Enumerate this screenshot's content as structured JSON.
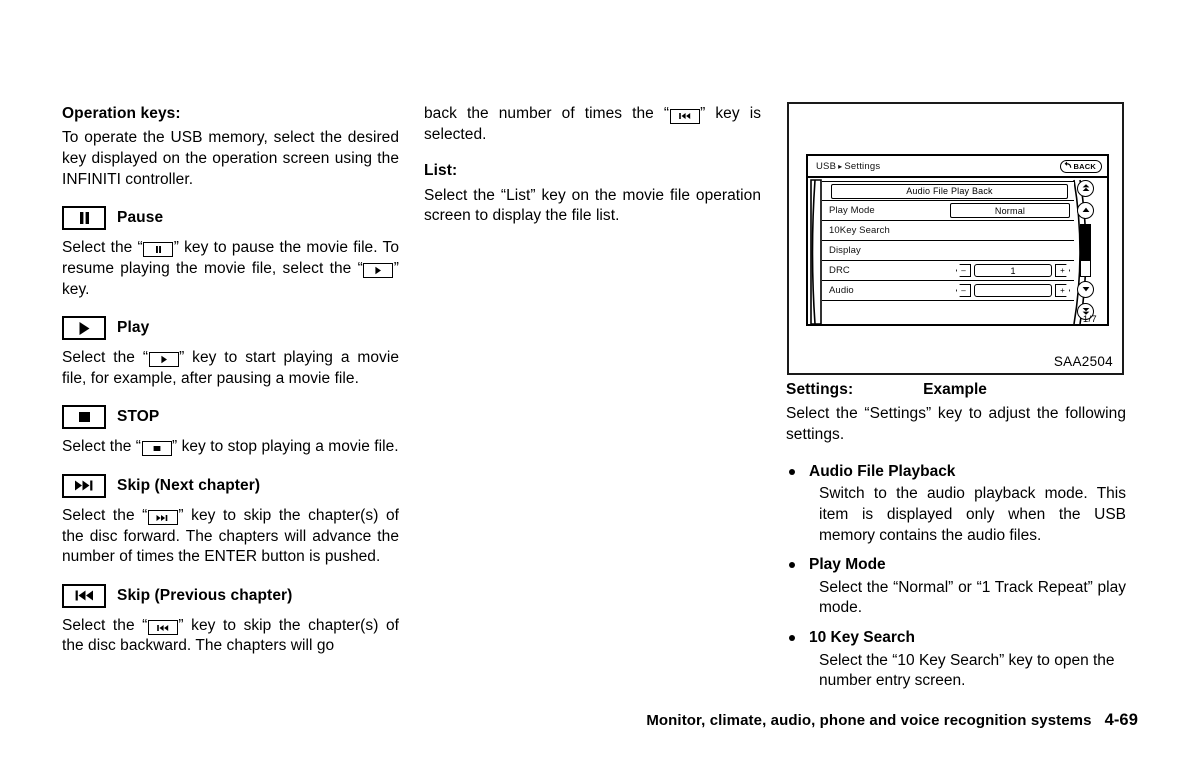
{
  "column_1": {
    "heading": "Operation keys:",
    "intro": "To operate the USB memory, select the desired key displayed on the operation screen using the INFINITI controller.",
    "keys": [
      {
        "icon": "pause-icon",
        "label": "Pause",
        "text_before": "Select the “",
        "text_after": "” key to pause the movie file. To resume playing the movie file, select the “",
        "text_end": "” key.",
        "inline_icon_1": "pause-icon",
        "inline_icon_2": "play-icon"
      },
      {
        "icon": "play-icon",
        "label": "Play",
        "text_before": "Select the “",
        "text_after": "” key to start playing a movie file, for example, after pausing a movie file.",
        "inline_icon_1": "play-icon"
      },
      {
        "icon": "stop-icon",
        "label": "STOP",
        "text_before": "Select the “",
        "text_after": "” key to stop playing a movie file.",
        "inline_icon_1": "stop-icon"
      },
      {
        "icon": "skip-next-icon",
        "label": "Skip (Next chapter)",
        "text_before": "Select the “",
        "text_after": "” key to skip the chapter(s) of the disc forward. The chapters will advance the number of times the ENTER button is pushed.",
        "inline_icon_1": "skip-next-icon"
      },
      {
        "icon": "skip-prev-icon",
        "label": "Skip (Previous chapter)",
        "text_before": "Select the “",
        "text_after": "” key to skip the chapter(s) of the disc backward. The chapters will go",
        "inline_icon_1": "skip-prev-icon"
      }
    ]
  },
  "column_2": {
    "continued_before": "back the number of times the “",
    "continued_icon": "skip-prev-icon",
    "continued_after": "” key is selected.",
    "list_heading": "List:",
    "list_body": "Select the “List” key on the movie file operation screen to display the file list."
  },
  "figure": {
    "code": "SAA2504",
    "caption": "Example",
    "screen": {
      "title_prefix": "USB",
      "title_separator": "▸",
      "title_suffix": "Settings",
      "back_button_label": "BACK",
      "back_button_icon": "back-arrow-icon",
      "rows": [
        {
          "type": "wide-button",
          "label": "Audio File Play Back"
        },
        {
          "type": "value",
          "label": "Play Mode",
          "value": "Normal"
        },
        {
          "type": "plain",
          "label": "10Key Search"
        },
        {
          "type": "plain",
          "label": "Display"
        },
        {
          "type": "stepper",
          "label": "DRC",
          "value": "1",
          "minus": "–",
          "plus": "+"
        },
        {
          "type": "stepper",
          "label": "Audio",
          "value": "",
          "minus": "–",
          "plus": "+"
        }
      ],
      "scroll_buttons": [
        {
          "name": "scroll-top-button",
          "icon": "double-up-arrow-icon"
        },
        {
          "name": "scroll-up-button",
          "icon": "up-arrow-icon"
        },
        {
          "name": "scroll-down-button",
          "icon": "down-arrow-icon"
        },
        {
          "name": "scroll-bottom-button",
          "icon": "double-down-arrow-icon"
        }
      ],
      "page_indicator": "1/7"
    }
  },
  "column_3": {
    "settings_heading": "Settings:",
    "settings_body": "Select the “Settings” key to adjust the following settings.",
    "items": [
      {
        "title": "Audio File Playback",
        "body": "Switch to the audio playback mode. This item is displayed only when the USB memory contains the audio files."
      },
      {
        "title": "Play Mode",
        "body": "Select the “Normal” or “1 Track Repeat” play mode."
      },
      {
        "title": "10 Key Search",
        "body": "Select the “10 Key Search” key to open the number entry screen."
      }
    ]
  },
  "footer": {
    "section_title": "Monitor, climate, audio, phone and voice recognition systems",
    "page_number": "4-69"
  },
  "colors": {
    "text": "#000000",
    "background": "#ffffff",
    "figure_border": "#1a1a1a"
  }
}
